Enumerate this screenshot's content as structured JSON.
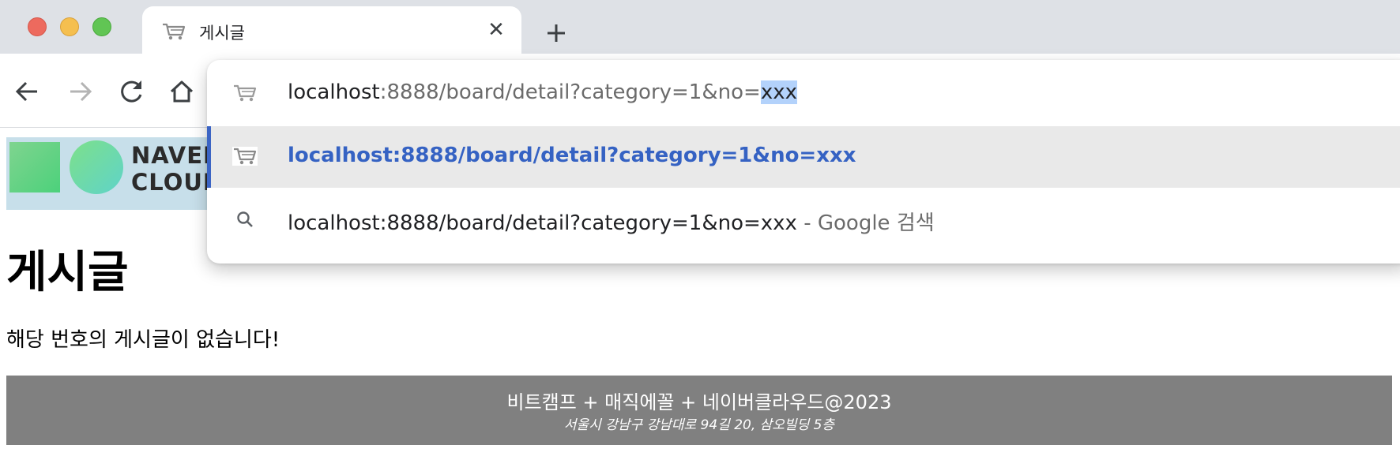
{
  "browser": {
    "tab": {
      "title": "게시글",
      "close_label": "✕",
      "icon": "cart-icon"
    },
    "new_tab_icon": "plus-icon",
    "nav": {
      "back_icon": "back-arrow-icon",
      "forward_icon": "forward-arrow-icon",
      "reload_icon": "reload-icon",
      "home_icon": "home-icon"
    }
  },
  "omnibox": {
    "input": {
      "host": "localhost",
      "path": ":8888/board/detail?category=1&no=",
      "selected": "xxx"
    },
    "suggestions": [
      {
        "icon": "cart-icon",
        "text": "localhost:8888/board/detail?category=1&no=xxx"
      },
      {
        "icon": "search-icon",
        "text": "localhost:8888/board/detail?category=1&no=xxx",
        "suffix": " - Google 검색"
      }
    ]
  },
  "page": {
    "logo": {
      "line1": "NAVER",
      "line2": "CLOUD"
    },
    "title": "게시글",
    "message": "해당 번호의 게시글이 없습니다!",
    "footer": {
      "line1": "비트캠프 + 매직에꼴 + 네이버클라우드@2023",
      "line2": "서울시 강남구 강남대로 94길 20, 삼오빌딩 5층"
    }
  },
  "colors": {
    "tabbar": "#dee1e6",
    "omnibox_accent": "#3b64c4",
    "suggestion_text": "#3562c3",
    "footer_bg": "#808080"
  }
}
